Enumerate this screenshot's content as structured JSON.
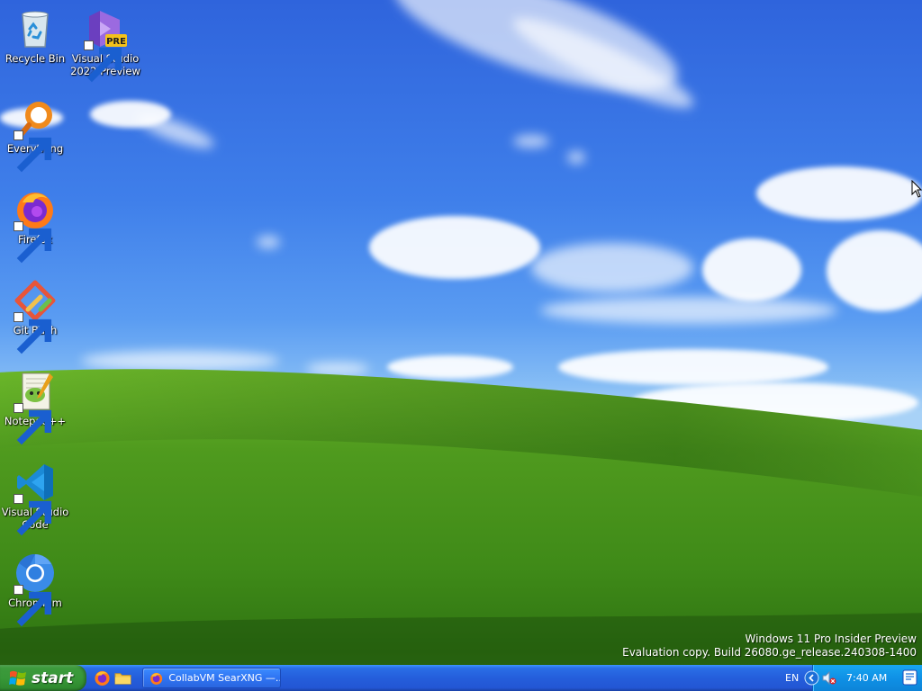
{
  "desktop": {
    "icons": [
      {
        "label": "Recycle Bin",
        "icon": "recycle-bin-icon",
        "shortcut": false
      },
      {
        "label": "Visual Studio\n2022 Preview",
        "icon": "visual-studio-preview-icon",
        "badge": "PRE",
        "shortcut": true
      },
      {
        "label": "Everything",
        "icon": "everything-search-icon",
        "shortcut": true
      },
      {
        "label": "Firefox",
        "icon": "firefox-icon",
        "shortcut": true
      },
      {
        "label": "Git Bash",
        "icon": "git-bash-icon",
        "shortcut": true
      },
      {
        "label": "Notepad++",
        "icon": "notepadpp-icon",
        "shortcut": true
      },
      {
        "label": "Visual Studio\nCode",
        "icon": "vscode-icon",
        "shortcut": true
      },
      {
        "label": "Chromium",
        "icon": "chromium-icon",
        "shortcut": true
      }
    ],
    "watermark": {
      "line1": "Windows 11 Pro Insider Preview",
      "line2": "Evaluation copy. Build 26080.ge_release.240308-1400"
    }
  },
  "taskbar": {
    "start_label": "start",
    "quick_launch": [
      "firefox-icon",
      "folder-icon"
    ],
    "tasks": [
      {
        "label": "CollabVM SearXNG —...",
        "icon": "firefox-icon"
      }
    ],
    "tray": {
      "language": "EN",
      "clock": "7:40 AM",
      "icons": [
        "chevron-left-icon",
        "volume-muted-icon",
        "notification-icon"
      ]
    }
  },
  "colors": {
    "taskbar_blue": "#245edb",
    "start_green": "#389838",
    "tray_blue": "#0f91e6",
    "sky_blue": "#3f7fea",
    "grass_green": "#4f9a1e"
  }
}
